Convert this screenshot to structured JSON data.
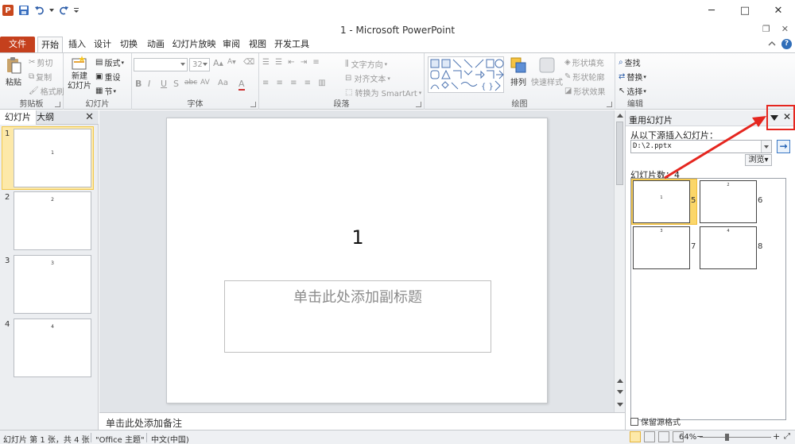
{
  "window": {
    "title": "1 - Microsoft PowerPoint",
    "minimize": "─",
    "maximize": "□",
    "close": "✕"
  },
  "ribbon_tabs": [
    "文件",
    "开始",
    "插入",
    "设计",
    "切换",
    "动画",
    "幻灯片放映",
    "审阅",
    "视图",
    "开发工具"
  ],
  "ribbon": {
    "clipboard": {
      "label": "剪贴板",
      "paste": "粘贴",
      "cut": "剪切",
      "copy": "复制",
      "format_painter": "格式刷"
    },
    "slides": {
      "label": "幻灯片",
      "new_slide_1": "新建",
      "new_slide_2": "幻灯片",
      "layout": "版式",
      "reset": "重设",
      "section": "节"
    },
    "font": {
      "label": "字体",
      "font_size": "32",
      "bold": "B",
      "italic": "I",
      "underline": "U",
      "shadow": "S",
      "strike": "abc",
      "spacing": "AV",
      "case": "Aa",
      "color": "A"
    },
    "paragraph": {
      "label": "段落",
      "text_direction": "文字方向",
      "align_text": "对齐文本",
      "smartart": "转换为 SmartArt"
    },
    "drawing": {
      "label": "绘图",
      "arrange": "排列",
      "quick_styles": "快速样式",
      "shape_fill": "形状填充",
      "shape_outline": "形状轮廓",
      "shape_effects": "形状效果"
    },
    "editing": {
      "label": "编辑",
      "find": "查找",
      "replace": "替换",
      "select": "选择"
    }
  },
  "slide_pane": {
    "tab_slides": "幻灯片",
    "tab_outline": "大纲",
    "close": "✕",
    "thumbnails": [
      {
        "num": "1",
        "text": "1"
      },
      {
        "num": "2",
        "text": "2"
      },
      {
        "num": "3",
        "text": "3"
      },
      {
        "num": "4",
        "text": "4"
      }
    ]
  },
  "slide": {
    "title": "1",
    "subtitle_placeholder": "单击此处添加副标题"
  },
  "notes": {
    "placeholder": "单击此处添加备注"
  },
  "reuse_pane": {
    "title": "重用幻灯片",
    "close": "✕",
    "source_label": "从以下源插入幻灯片：",
    "path": "D:\\2.pptx",
    "browse": "浏览",
    "count_label": "幻灯片数：4",
    "slides": [
      {
        "num": "5",
        "text": "1"
      },
      {
        "num": "6",
        "text": "2"
      },
      {
        "num": "7",
        "text": "3"
      },
      {
        "num": "8",
        "text": "4"
      }
    ],
    "keep_format": "保留源格式"
  },
  "status": {
    "slide_info": "幻灯片 第 1 张，共 4 张",
    "theme": "\"Office 主题\"",
    "language": "中文(中国)",
    "zoom": "64%"
  },
  "colors": {
    "file_tab": "#c5401d",
    "selection_fill": "#fde9a9",
    "annotation_red": "#e5261f"
  }
}
